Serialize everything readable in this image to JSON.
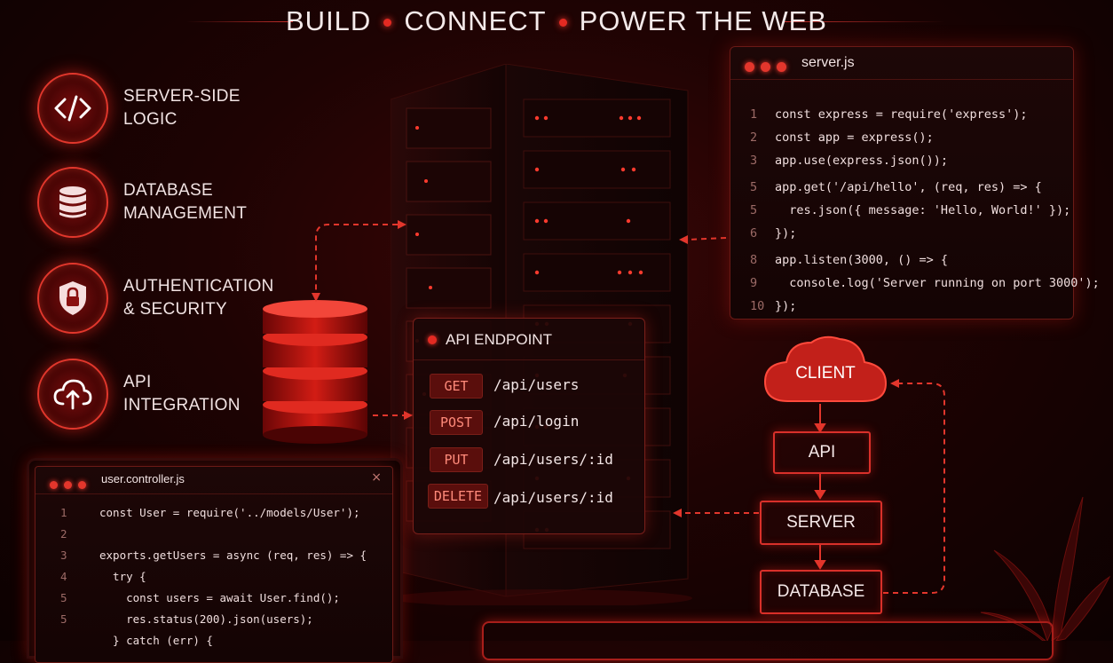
{
  "header": {
    "words": [
      "BUILD",
      "CONNECT",
      "POWER THE WEB"
    ]
  },
  "features": [
    {
      "icon": "code-icon",
      "line1": "SERVER-SIDE",
      "line2": "LOGIC"
    },
    {
      "icon": "database-icon",
      "line1": "DATABASE",
      "line2": "MANAGEMENT"
    },
    {
      "icon": "lock-icon",
      "line1": "AUTHENTICATION",
      "line2": "& SECURITY"
    },
    {
      "icon": "cloud-upload-icon",
      "line1": "API",
      "line2": "INTEGRATION"
    }
  ],
  "server_code": {
    "filename": "server.js",
    "lines": [
      {
        "n": "1",
        "text": "const express = require('express');"
      },
      {
        "n": "2",
        "text": "const app = express();"
      },
      {
        "n": "3",
        "text": "app.use(express.json());"
      },
      {
        "n": "5",
        "text": "app.get('/api/hello', (req, res) => {"
      },
      {
        "n": "5",
        "text": "  res.json({ message: 'Hello, World!' });"
      },
      {
        "n": "6",
        "text": "});"
      },
      {
        "n": "8",
        "text": "app.listen(3000, () => {"
      },
      {
        "n": "9",
        "text": "  console.log('Server running on port 3000');"
      },
      {
        "n": "10",
        "text": "});"
      }
    ]
  },
  "controller_code": {
    "filename": "user.controller.js",
    "close": "×",
    "lines": [
      {
        "n": "1",
        "text": "const User = require('../models/User');"
      },
      {
        "n": "2",
        "text": ""
      },
      {
        "n": "3",
        "text": "exports.getUsers = async (req, res) => {"
      },
      {
        "n": "4",
        "text": "  try {"
      },
      {
        "n": "5",
        "text": "    const users = await User.find();"
      },
      {
        "n": "5",
        "text": "    res.status(200).json(users);"
      },
      {
        "n": "",
        "text": "  } catch (err) {"
      }
    ]
  },
  "api_panel": {
    "title": "API ENDPOINT",
    "endpoints": [
      {
        "method": "GET",
        "route": "/api/users"
      },
      {
        "method": "POST",
        "route": "/api/login"
      },
      {
        "method": "PUT",
        "route": "/api/users/:id"
      },
      {
        "method": "DELETE",
        "route": "/api/users/:id"
      }
    ]
  },
  "flow": {
    "client": "CLIENT",
    "api": "API",
    "server": "SERVER",
    "database": "DATABASE"
  },
  "colors": {
    "accent": "#e32a22",
    "background": "#1e0303",
    "glow": "#ff3a30"
  }
}
